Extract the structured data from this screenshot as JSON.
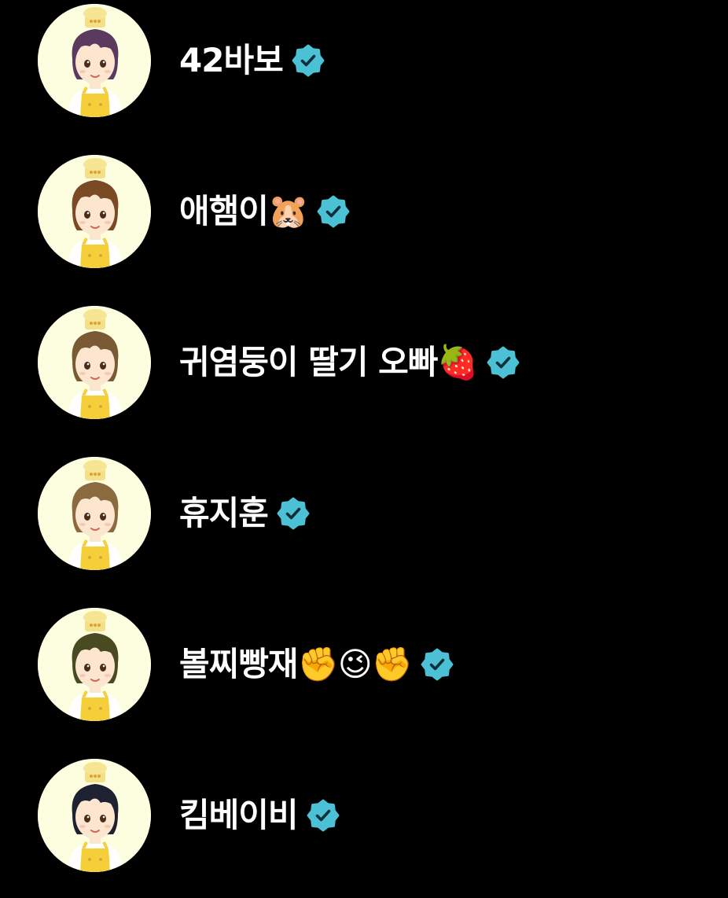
{
  "colors": {
    "background": "#000000",
    "name_text": "#ffffff",
    "verified_badge": "#4cc1d6",
    "avatar_bg": "#fdfde0"
  },
  "accounts": [
    {
      "name": "42바보",
      "badge_icon": "verified-badge-icon",
      "avatar_icon": "chef-character-avatar",
      "hair": "#5a3a5e"
    },
    {
      "name": "애햄이🐹",
      "badge_icon": "verified-badge-icon",
      "avatar_icon": "chef-character-avatar",
      "hair": "#7a4a24"
    },
    {
      "name": "귀염둥이 딸기 오빠🍓",
      "badge_icon": "verified-badge-icon",
      "avatar_icon": "chef-character-avatar",
      "hair": "#7a5a34"
    },
    {
      "name": "휴지훈",
      "badge_icon": "verified-badge-icon",
      "avatar_icon": "chef-character-avatar",
      "hair": "#8a6a3e"
    },
    {
      "name": "볼찌빵재✊😉✊",
      "badge_icon": "verified-badge-icon",
      "avatar_icon": "chef-character-avatar",
      "hair": "#4a4a22"
    },
    {
      "name": "킴베이비",
      "badge_icon": "verified-badge-icon",
      "avatar_icon": "chef-character-avatar",
      "hair": "#1e2230"
    }
  ]
}
